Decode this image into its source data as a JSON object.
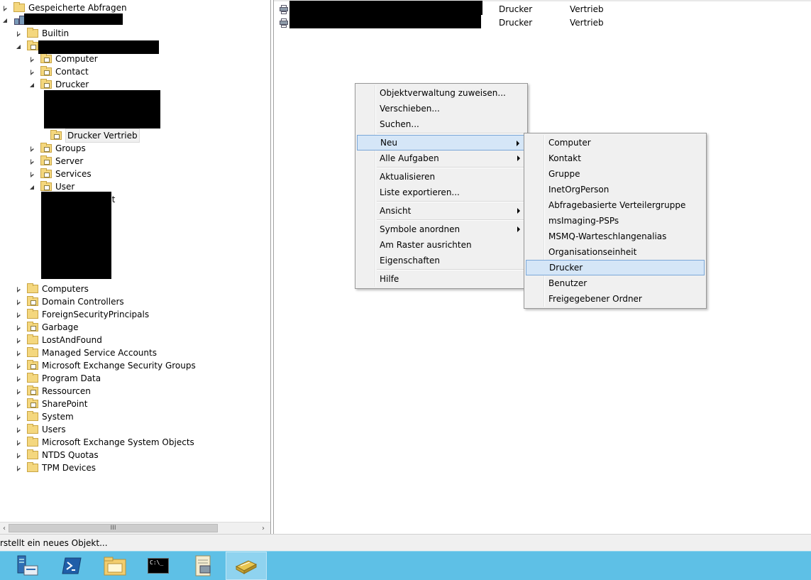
{
  "tree": {
    "saved_queries": "Gespeicherte Abfragen",
    "domain_nodes": [
      {
        "label": "Builtin",
        "type": "folder",
        "exp": "closed"
      }
    ],
    "ou_children": [
      {
        "label": "Computer"
      },
      {
        "label": "Contact"
      },
      {
        "label": "Drucker"
      }
    ],
    "selected_node": "Drucker Vertrieb",
    "ou_children_after": [
      {
        "label": "Groups"
      },
      {
        "label": "Server"
      },
      {
        "label": "Services"
      },
      {
        "label": "User"
      }
    ],
    "partial_text": "nt",
    "root_children": [
      {
        "label": "Computers",
        "ou": false
      },
      {
        "label": "Domain Controllers",
        "ou": true
      },
      {
        "label": "ForeignSecurityPrincipals",
        "ou": false
      },
      {
        "label": "Garbage",
        "ou": true
      },
      {
        "label": "LostAndFound",
        "ou": false
      },
      {
        "label": "Managed Service Accounts",
        "ou": false
      },
      {
        "label": "Microsoft Exchange Security Groups",
        "ou": true
      },
      {
        "label": "Program Data",
        "ou": false
      },
      {
        "label": "Ressourcen",
        "ou": true
      },
      {
        "label": "SharePoint",
        "ou": true
      },
      {
        "label": "System",
        "ou": false
      },
      {
        "label": "Users",
        "ou": false
      },
      {
        "label": "Microsoft Exchange System Objects",
        "ou": false
      },
      {
        "label": "NTDS Quotas",
        "ou": false
      },
      {
        "label": "TPM Devices",
        "ou": false
      }
    ],
    "scroll_thumb_label": "III"
  },
  "list": {
    "rows": [
      {
        "type": "Drucker",
        "description": "Vertrieb"
      },
      {
        "type": "Drucker",
        "description": "Vertrieb"
      }
    ]
  },
  "context_menu": {
    "items": [
      {
        "label": "Objektverwaltung zuweisen...",
        "sub": false
      },
      {
        "label": "Verschieben...",
        "sub": false
      },
      {
        "label": "Suchen...",
        "sub": false
      },
      {
        "label": "Neu",
        "sub": true,
        "highlight": true
      },
      {
        "label": "Alle Aufgaben",
        "sub": true
      },
      {
        "label": "Aktualisieren",
        "sub": false
      },
      {
        "label": "Liste exportieren...",
        "sub": false
      },
      {
        "label": "Ansicht",
        "sub": true
      },
      {
        "label": "Symbole anordnen",
        "sub": true
      },
      {
        "label": "Am Raster ausrichten",
        "sub": false
      },
      {
        "label": "Eigenschaften",
        "sub": false
      },
      {
        "label": "Hilfe",
        "sub": false
      }
    ]
  },
  "submenu_new": {
    "items": [
      {
        "label": "Computer"
      },
      {
        "label": "Kontakt"
      },
      {
        "label": "Gruppe"
      },
      {
        "label": "InetOrgPerson"
      },
      {
        "label": "Abfragebasierte Verteilergruppe"
      },
      {
        "label": "msImaging-PSPs"
      },
      {
        "label": "MSMQ-Warteschlangenalias"
      },
      {
        "label": "Organisationseinheit"
      },
      {
        "label": "Drucker",
        "highlight": true
      },
      {
        "label": "Benutzer"
      },
      {
        "label": "Freigegebener Ordner"
      }
    ]
  },
  "status_bar": {
    "text": "rstellt ein neues Objekt..."
  },
  "taskbar": {
    "buttons": [
      {
        "icon": "server-manager-icon"
      },
      {
        "icon": "powershell-icon"
      },
      {
        "icon": "file-explorer-icon"
      },
      {
        "icon": "command-prompt-icon",
        "glyph": "C:\\_"
      },
      {
        "icon": "notepad-icon"
      },
      {
        "icon": "active-directory-icon",
        "active": true
      }
    ],
    "accent": "#5ec0e6"
  }
}
